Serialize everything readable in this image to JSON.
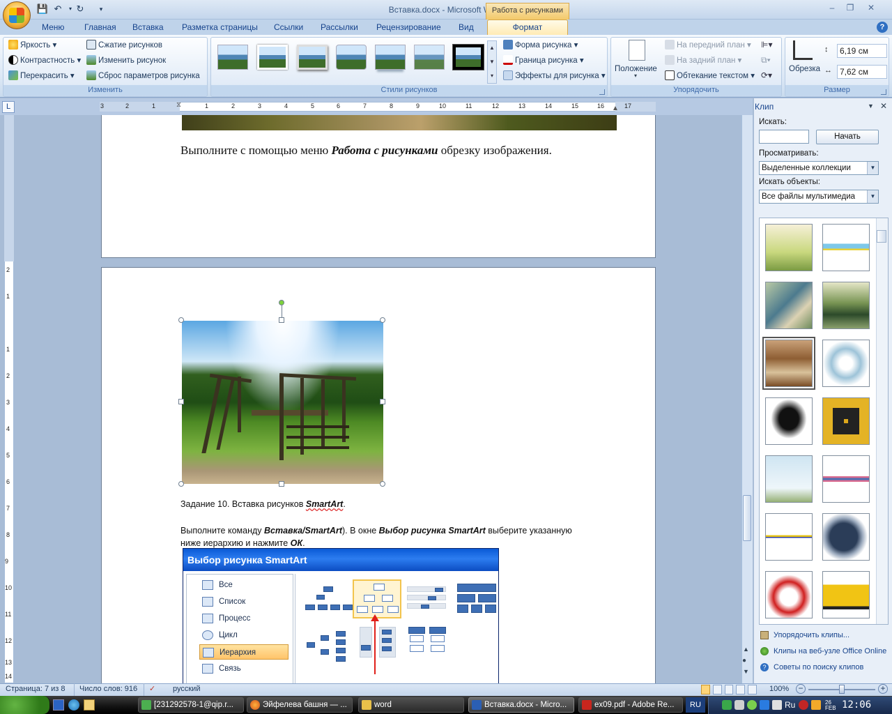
{
  "window": {
    "title": "Вставка.docx - Microsoft Word",
    "context_tab": "Работа с рисунками"
  },
  "tabs": [
    "Меню",
    "Главная",
    "Вставка",
    "Разметка страницы",
    "Ссылки",
    "Рассылки",
    "Рецензирование",
    "Вид",
    "Формат"
  ],
  "ribbon": {
    "adjust": {
      "label": "Изменить",
      "items": [
        "Яркость",
        "Контрастность",
        "Перекрасить",
        "Сжатие рисунков",
        "Изменить рисунок",
        "Сброс параметров рисунка"
      ]
    },
    "styles": {
      "label": "Стили рисунков",
      "items": [
        "Форма рисунка",
        "Граница рисунка",
        "Эффекты для рисунка"
      ]
    },
    "arrange": {
      "label": "Упорядочить",
      "position": "Положение",
      "items": [
        "На передний план",
        "На задний план",
        "Обтекание текстом"
      ]
    },
    "size": {
      "label": "Размер",
      "crop": "Обрезка",
      "height": "6,19 см",
      "width": "7,62 см"
    }
  },
  "ruler": {
    "numbers": [
      "3",
      "2",
      "1",
      "1",
      "2",
      "3",
      "4",
      "5",
      "6",
      "7",
      "8",
      "9",
      "10",
      "11",
      "12",
      "13",
      "14",
      "15",
      "16",
      "17"
    ],
    "vnumbers": [
      "2",
      "1",
      "1",
      "2",
      "3",
      "4",
      "5",
      "6",
      "7",
      "8",
      "9",
      "10",
      "11",
      "12",
      "13",
      "14"
    ]
  },
  "document": {
    "line1_plain": "Выполните с помощью меню ",
    "line1_bold": "Работа с рисунками",
    "line1_end": " обрезку изображения.",
    "task10_plain": "Задание 10. Вставка рисунков ",
    "task10_bold": "SmartArt",
    "task10_end": ".",
    "instr_1": "Выполните команду ",
    "instr_b1": "Вставка/SmartArt",
    "instr_2": "). В окне ",
    "instr_b2": "Выбор рисунка SmartArt",
    "instr_3": " выберите указанную",
    "instr_4": "ниже иерархию и нажмите ",
    "instr_b3": "ОК",
    "instr_5": "."
  },
  "smartart_dialog": {
    "title": "Выбор рисунка SmartArt",
    "categories": [
      "Все",
      "Список",
      "Процесс",
      "Цикл",
      "Иерархия",
      "Связь"
    ],
    "selected": "Иерархия"
  },
  "taskpane": {
    "title": "Клип",
    "search_label": "Искать:",
    "search_value": "",
    "go_button": "Начать",
    "browse_label": "Просматривать:",
    "browse_value": "Выделенные коллекции",
    "objects_label": "Искать объекты:",
    "objects_value": "Все файлы мультимедиа",
    "links": [
      "Упорядочить клипы...",
      "Клипы на веб-узле Office Online",
      "Советы по поиску клипов"
    ]
  },
  "statusbar": {
    "page": "Страница: 7 из 8",
    "words": "Число слов: 916",
    "lang": "русский",
    "zoom": "100%"
  },
  "taskbar": {
    "tasks": [
      "[231292578-1@qip.r...",
      "Эйфелева башня — ...",
      "word",
      "Вставка.docx - Micro...",
      "ex09.pdf - Adobe Re..."
    ],
    "lang": "RU",
    "tray_lang": "Ru",
    "time": "12:06",
    "date": "26 FEB"
  }
}
